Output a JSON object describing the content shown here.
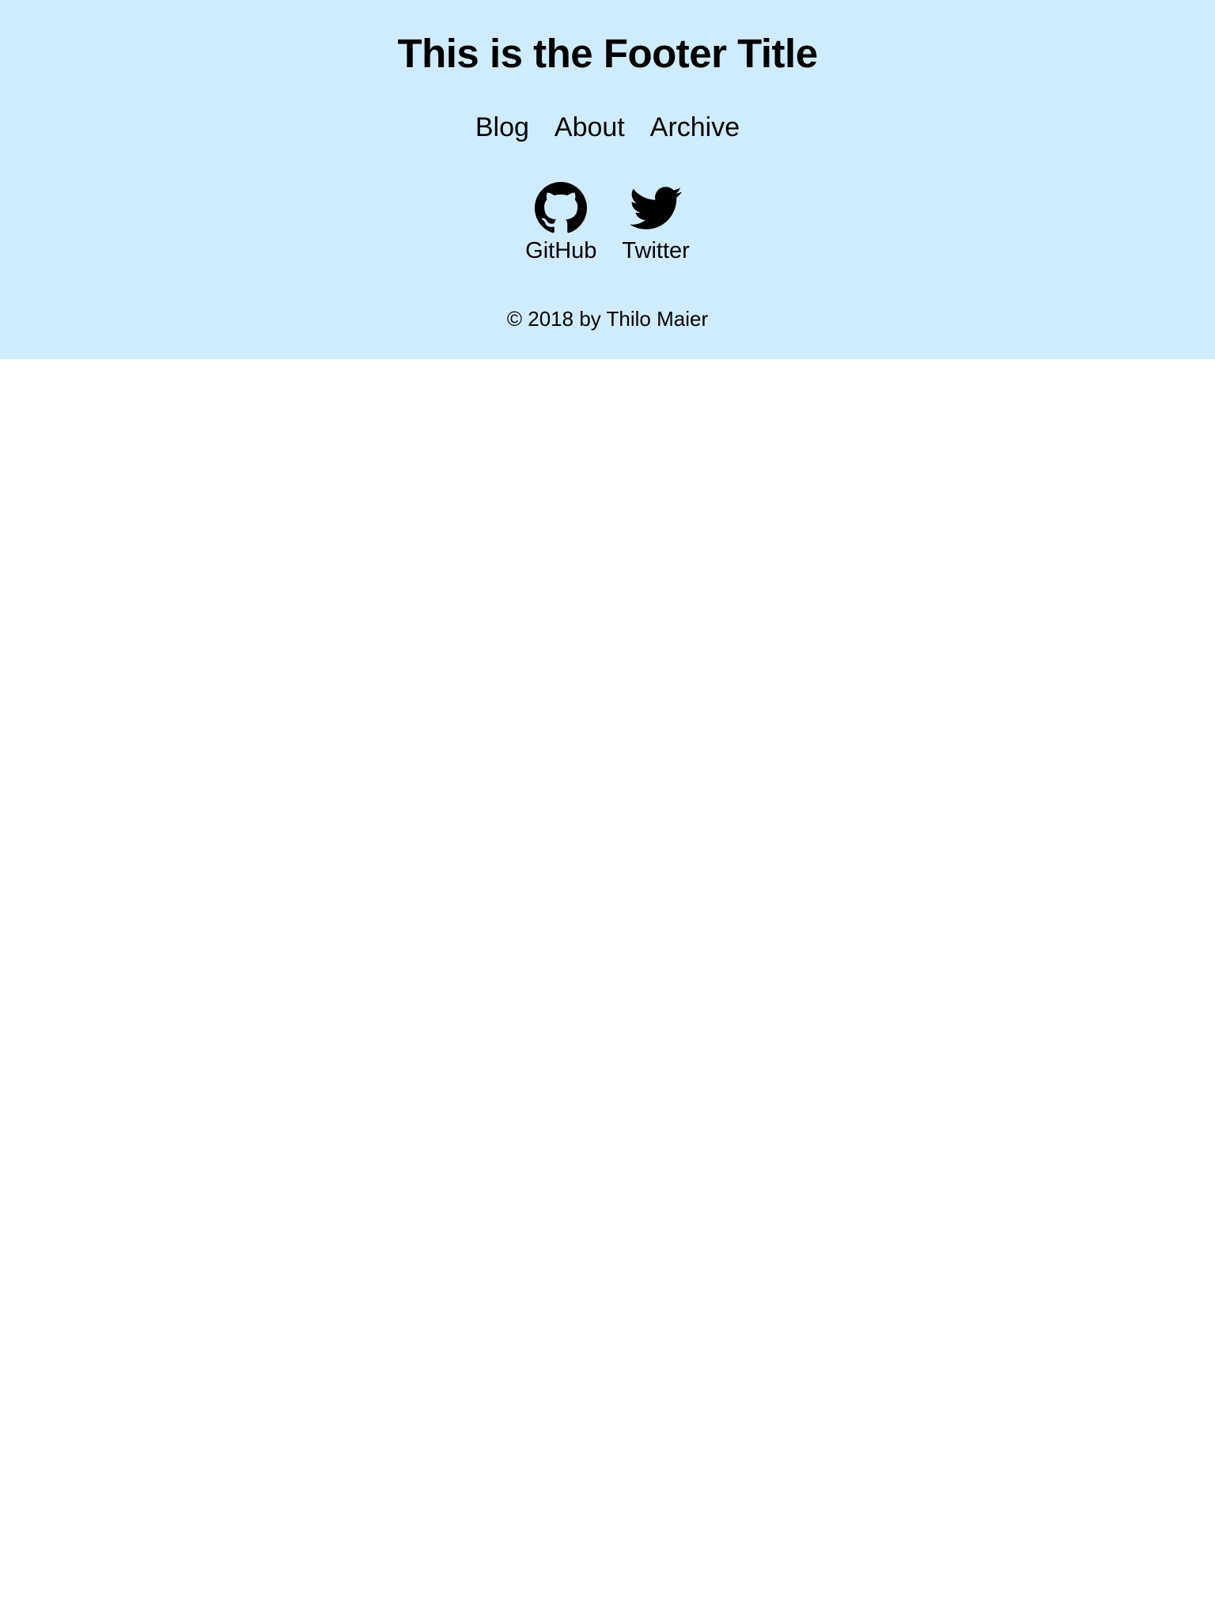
{
  "footer": {
    "title": "This is the Footer Title",
    "background": "#cfecfe",
    "nav": [
      {
        "label": "Blog"
      },
      {
        "label": "About"
      },
      {
        "label": "Archive"
      }
    ],
    "social": [
      {
        "label": "GitHub",
        "icon": "github-icon"
      },
      {
        "label": "Twitter",
        "icon": "twitter-icon"
      }
    ],
    "copyright": "© 2018 by Thilo Maier"
  }
}
